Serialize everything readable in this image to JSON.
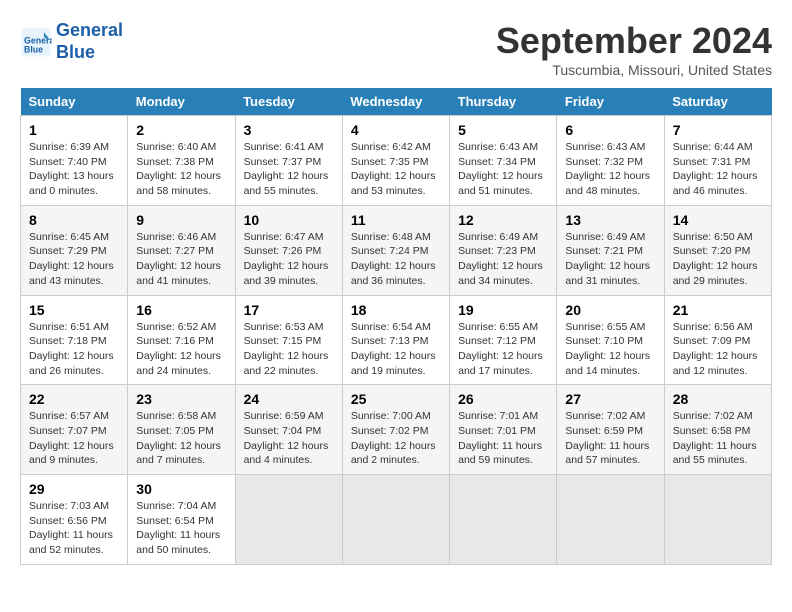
{
  "header": {
    "logo_line1": "General",
    "logo_line2": "Blue",
    "month": "September 2024",
    "location": "Tuscumbia, Missouri, United States"
  },
  "weekdays": [
    "Sunday",
    "Monday",
    "Tuesday",
    "Wednesday",
    "Thursday",
    "Friday",
    "Saturday"
  ],
  "weeks": [
    [
      {
        "day": "1",
        "sunrise": "6:39 AM",
        "sunset": "7:40 PM",
        "daylight": "13 hours and 0 minutes."
      },
      {
        "day": "2",
        "sunrise": "6:40 AM",
        "sunset": "7:38 PM",
        "daylight": "12 hours and 58 minutes."
      },
      {
        "day": "3",
        "sunrise": "6:41 AM",
        "sunset": "7:37 PM",
        "daylight": "12 hours and 55 minutes."
      },
      {
        "day": "4",
        "sunrise": "6:42 AM",
        "sunset": "7:35 PM",
        "daylight": "12 hours and 53 minutes."
      },
      {
        "day": "5",
        "sunrise": "6:43 AM",
        "sunset": "7:34 PM",
        "daylight": "12 hours and 51 minutes."
      },
      {
        "day": "6",
        "sunrise": "6:43 AM",
        "sunset": "7:32 PM",
        "daylight": "12 hours and 48 minutes."
      },
      {
        "day": "7",
        "sunrise": "6:44 AM",
        "sunset": "7:31 PM",
        "daylight": "12 hours and 46 minutes."
      }
    ],
    [
      {
        "day": "8",
        "sunrise": "6:45 AM",
        "sunset": "7:29 PM",
        "daylight": "12 hours and 43 minutes."
      },
      {
        "day": "9",
        "sunrise": "6:46 AM",
        "sunset": "7:27 PM",
        "daylight": "12 hours and 41 minutes."
      },
      {
        "day": "10",
        "sunrise": "6:47 AM",
        "sunset": "7:26 PM",
        "daylight": "12 hours and 39 minutes."
      },
      {
        "day": "11",
        "sunrise": "6:48 AM",
        "sunset": "7:24 PM",
        "daylight": "12 hours and 36 minutes."
      },
      {
        "day": "12",
        "sunrise": "6:49 AM",
        "sunset": "7:23 PM",
        "daylight": "12 hours and 34 minutes."
      },
      {
        "day": "13",
        "sunrise": "6:49 AM",
        "sunset": "7:21 PM",
        "daylight": "12 hours and 31 minutes."
      },
      {
        "day": "14",
        "sunrise": "6:50 AM",
        "sunset": "7:20 PM",
        "daylight": "12 hours and 29 minutes."
      }
    ],
    [
      {
        "day": "15",
        "sunrise": "6:51 AM",
        "sunset": "7:18 PM",
        "daylight": "12 hours and 26 minutes."
      },
      {
        "day": "16",
        "sunrise": "6:52 AM",
        "sunset": "7:16 PM",
        "daylight": "12 hours and 24 minutes."
      },
      {
        "day": "17",
        "sunrise": "6:53 AM",
        "sunset": "7:15 PM",
        "daylight": "12 hours and 22 minutes."
      },
      {
        "day": "18",
        "sunrise": "6:54 AM",
        "sunset": "7:13 PM",
        "daylight": "12 hours and 19 minutes."
      },
      {
        "day": "19",
        "sunrise": "6:55 AM",
        "sunset": "7:12 PM",
        "daylight": "12 hours and 17 minutes."
      },
      {
        "day": "20",
        "sunrise": "6:55 AM",
        "sunset": "7:10 PM",
        "daylight": "12 hours and 14 minutes."
      },
      {
        "day": "21",
        "sunrise": "6:56 AM",
        "sunset": "7:09 PM",
        "daylight": "12 hours and 12 minutes."
      }
    ],
    [
      {
        "day": "22",
        "sunrise": "6:57 AM",
        "sunset": "7:07 PM",
        "daylight": "12 hours and 9 minutes."
      },
      {
        "day": "23",
        "sunrise": "6:58 AM",
        "sunset": "7:05 PM",
        "daylight": "12 hours and 7 minutes."
      },
      {
        "day": "24",
        "sunrise": "6:59 AM",
        "sunset": "7:04 PM",
        "daylight": "12 hours and 4 minutes."
      },
      {
        "day": "25",
        "sunrise": "7:00 AM",
        "sunset": "7:02 PM",
        "daylight": "12 hours and 2 minutes."
      },
      {
        "day": "26",
        "sunrise": "7:01 AM",
        "sunset": "7:01 PM",
        "daylight": "11 hours and 59 minutes."
      },
      {
        "day": "27",
        "sunrise": "7:02 AM",
        "sunset": "6:59 PM",
        "daylight": "11 hours and 57 minutes."
      },
      {
        "day": "28",
        "sunrise": "7:02 AM",
        "sunset": "6:58 PM",
        "daylight": "11 hours and 55 minutes."
      }
    ],
    [
      {
        "day": "29",
        "sunrise": "7:03 AM",
        "sunset": "6:56 PM",
        "daylight": "11 hours and 52 minutes."
      },
      {
        "day": "30",
        "sunrise": "7:04 AM",
        "sunset": "6:54 PM",
        "daylight": "11 hours and 50 minutes."
      },
      null,
      null,
      null,
      null,
      null
    ]
  ],
  "labels": {
    "sunrise": "Sunrise:",
    "sunset": "Sunset:",
    "daylight": "Daylight:"
  }
}
